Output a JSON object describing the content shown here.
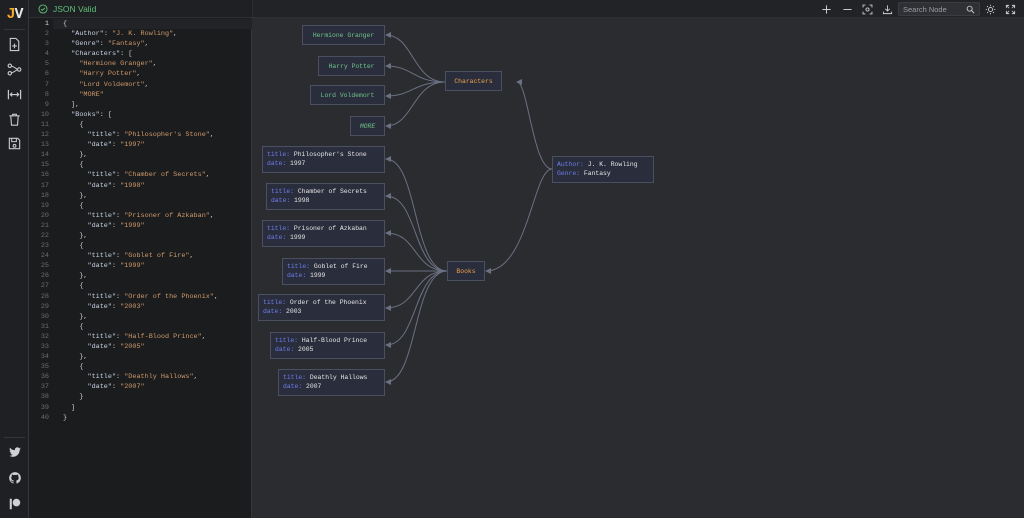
{
  "app": {
    "logo_j": "J",
    "logo_v": "V"
  },
  "sidebar": {
    "tools": [
      {
        "name": "add-file-icon"
      },
      {
        "name": "graph-icon"
      },
      {
        "name": "expand-horizontal-icon"
      },
      {
        "name": "trash-icon"
      },
      {
        "name": "save-icon"
      }
    ],
    "social": [
      {
        "name": "twitter-icon"
      },
      {
        "name": "github-icon"
      },
      {
        "name": "patreon-icon"
      }
    ]
  },
  "editor": {
    "status": "JSON Valid",
    "status_color": "#5fbf7a",
    "active_line": 1,
    "lines": [
      "1",
      "2",
      "3",
      "4",
      "5",
      "6",
      "7",
      "8",
      "9",
      "10",
      "11",
      "12",
      "13",
      "14",
      "15",
      "16",
      "17",
      "18",
      "19",
      "20",
      "21",
      "22",
      "23",
      "24",
      "25",
      "26",
      "27",
      "28",
      "29",
      "30",
      "31",
      "32",
      "33",
      "34",
      "35",
      "36",
      "37",
      "38",
      "39",
      "40"
    ],
    "code": [
      [
        [
          "p",
          "{"
        ]
      ],
      [
        [
          "p",
          "  "
        ],
        [
          "k",
          "\"Author\""
        ],
        [
          "p",
          ": "
        ],
        [
          "s",
          "\"J. K. Rowling\""
        ],
        [
          "p",
          ","
        ]
      ],
      [
        [
          "p",
          "  "
        ],
        [
          "k",
          "\"Genre\""
        ],
        [
          "p",
          ": "
        ],
        [
          "s",
          "\"Fantasy\""
        ],
        [
          "p",
          ","
        ]
      ],
      [
        [
          "p",
          "  "
        ],
        [
          "k",
          "\"Characters\""
        ],
        [
          "p",
          ": ["
        ]
      ],
      [
        [
          "p",
          "    "
        ],
        [
          "s",
          "\"Hermione Granger\""
        ],
        [
          "p",
          ","
        ]
      ],
      [
        [
          "p",
          "    "
        ],
        [
          "s",
          "\"Harry Potter\""
        ],
        [
          "p",
          ","
        ]
      ],
      [
        [
          "p",
          "    "
        ],
        [
          "s",
          "\"Lord Voldemort\""
        ],
        [
          "p",
          ","
        ]
      ],
      [
        [
          "p",
          "    "
        ],
        [
          "s",
          "\"MORE\""
        ]
      ],
      [
        [
          "p",
          "  ],"
        ]
      ],
      [
        [
          "p",
          "  "
        ],
        [
          "k",
          "\"Books\""
        ],
        [
          "p",
          ": ["
        ]
      ],
      [
        [
          "p",
          "    {"
        ]
      ],
      [
        [
          "p",
          "      "
        ],
        [
          "k",
          "\"title\""
        ],
        [
          "p",
          ": "
        ],
        [
          "s",
          "\"Philosopher's Stone\""
        ],
        [
          "p",
          ","
        ]
      ],
      [
        [
          "p",
          "      "
        ],
        [
          "k",
          "\"date\""
        ],
        [
          "p",
          ": "
        ],
        [
          "s",
          "\"1997\""
        ]
      ],
      [
        [
          "p",
          "    },"
        ]
      ],
      [
        [
          "p",
          "    {"
        ]
      ],
      [
        [
          "p",
          "      "
        ],
        [
          "k",
          "\"title\""
        ],
        [
          "p",
          ": "
        ],
        [
          "s",
          "\"Chamber of Secrets\""
        ],
        [
          "p",
          ","
        ]
      ],
      [
        [
          "p",
          "      "
        ],
        [
          "k",
          "\"date\""
        ],
        [
          "p",
          ": "
        ],
        [
          "s",
          "\"1998\""
        ]
      ],
      [
        [
          "p",
          "    },"
        ]
      ],
      [
        [
          "p",
          "    {"
        ]
      ],
      [
        [
          "p",
          "      "
        ],
        [
          "k",
          "\"title\""
        ],
        [
          "p",
          ": "
        ],
        [
          "s",
          "\"Prisoner of Azkaban\""
        ],
        [
          "p",
          ","
        ]
      ],
      [
        [
          "p",
          "      "
        ],
        [
          "k",
          "\"date\""
        ],
        [
          "p",
          ": "
        ],
        [
          "s",
          "\"1999\""
        ]
      ],
      [
        [
          "p",
          "    },"
        ]
      ],
      [
        [
          "p",
          "    {"
        ]
      ],
      [
        [
          "p",
          "      "
        ],
        [
          "k",
          "\"title\""
        ],
        [
          "p",
          ": "
        ],
        [
          "s",
          "\"Goblet of Fire\""
        ],
        [
          "p",
          ","
        ]
      ],
      [
        [
          "p",
          "      "
        ],
        [
          "k",
          "\"date\""
        ],
        [
          "p",
          ": "
        ],
        [
          "s",
          "\"1999\""
        ]
      ],
      [
        [
          "p",
          "    },"
        ]
      ],
      [
        [
          "p",
          "    {"
        ]
      ],
      [
        [
          "p",
          "      "
        ],
        [
          "k",
          "\"title\""
        ],
        [
          "p",
          ": "
        ],
        [
          "s",
          "\"Order of the Phoenix\""
        ],
        [
          "p",
          ","
        ]
      ],
      [
        [
          "p",
          "      "
        ],
        [
          "k",
          "\"date\""
        ],
        [
          "p",
          ": "
        ],
        [
          "s",
          "\"2003\""
        ]
      ],
      [
        [
          "p",
          "    },"
        ]
      ],
      [
        [
          "p",
          "    {"
        ]
      ],
      [
        [
          "p",
          "      "
        ],
        [
          "k",
          "\"title\""
        ],
        [
          "p",
          ": "
        ],
        [
          "s",
          "\"Half-Blood Prince\""
        ],
        [
          "p",
          ","
        ]
      ],
      [
        [
          "p",
          "      "
        ],
        [
          "k",
          "\"date\""
        ],
        [
          "p",
          ": "
        ],
        [
          "s",
          "\"2005\""
        ]
      ],
      [
        [
          "p",
          "    },"
        ]
      ],
      [
        [
          "p",
          "    {"
        ]
      ],
      [
        [
          "p",
          "      "
        ],
        [
          "k",
          "\"title\""
        ],
        [
          "p",
          ": "
        ],
        [
          "s",
          "\"Deathly Hallows\""
        ],
        [
          "p",
          ","
        ]
      ],
      [
        [
          "p",
          "      "
        ],
        [
          "k",
          "\"date\""
        ],
        [
          "p",
          ": "
        ],
        [
          "s",
          "\"2007\""
        ]
      ],
      [
        [
          "p",
          "    }"
        ]
      ],
      [
        [
          "p",
          "  ]"
        ]
      ],
      [
        [
          "p",
          "}"
        ]
      ]
    ]
  },
  "toolbar": {
    "buttons": [
      {
        "name": "zoom-in-icon"
      },
      {
        "name": "zoom-out-icon"
      },
      {
        "name": "fit-view-icon"
      },
      {
        "name": "download-icon"
      }
    ],
    "search_placeholder": "Search Node",
    "right_buttons": [
      {
        "name": "theme-toggle-icon"
      },
      {
        "name": "fullscreen-icon"
      }
    ]
  },
  "graph": {
    "colors": {
      "key": "#6d7eee",
      "green": "#6ec58a",
      "orange": "#f0a24a",
      "edge": "#6b7183"
    },
    "root": {
      "author_key": "Author:",
      "author_val": "J. K. Rowling",
      "genre_key": "Genre:",
      "genre_val": "Fantasy"
    },
    "characters_label": "Characters",
    "books_label": "Books",
    "characters": [
      "Hermione Granger",
      "Harry Potter",
      "Lord Voldemort",
      "MORE"
    ],
    "books": [
      {
        "title_key": "title:",
        "title": "Philosopher's Stone",
        "date_key": "date:",
        "date": "1997"
      },
      {
        "title_key": "title:",
        "title": "Chamber of Secrets",
        "date_key": "date:",
        "date": "1998"
      },
      {
        "title_key": "title:",
        "title": "Prisoner of Azkaban",
        "date_key": "date:",
        "date": "1999"
      },
      {
        "title_key": "title:",
        "title": "Goblet of Fire",
        "date_key": "date:",
        "date": "1999"
      },
      {
        "title_key": "title:",
        "title": "Order of the Phoenix",
        "date_key": "date:",
        "date": "2003"
      },
      {
        "title_key": "title:",
        "title": "Half-Blood Prince",
        "date_key": "date:",
        "date": "2005"
      },
      {
        "title_key": "title:",
        "title": "Deathly Hallows",
        "date_key": "date:",
        "date": "2007"
      }
    ]
  }
}
